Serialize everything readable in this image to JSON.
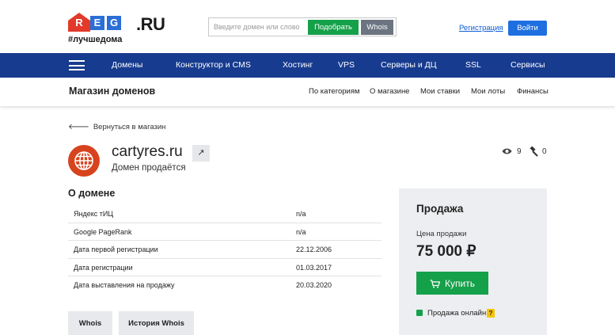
{
  "header": {
    "logo": {
      "letters": [
        "R",
        "E",
        "G"
      ],
      "suffix": ".RU",
      "tagline": "#лучшедома"
    },
    "search": {
      "placeholder": "Введите домен или слово",
      "pick_label": "Подобрать",
      "whois_label": "Whois"
    },
    "register_link": "Регистрация",
    "login_label": "Войти"
  },
  "nav": {
    "items": [
      "Домены",
      "Конструктор и CMS",
      "Хостинг",
      "VPS",
      "Серверы и ДЦ",
      "SSL",
      "Сервисы"
    ]
  },
  "subnav": {
    "title": "Магазин доменов",
    "items": [
      "По категориям",
      "О магазине",
      "Мои ставки",
      "Мои лоты",
      "Финансы"
    ]
  },
  "back_link": "Вернуться в магазин",
  "domain": {
    "name": "cartyres.ru",
    "status": "Домен продаётся",
    "views": "9",
    "bids": "0"
  },
  "about": {
    "title": "О домене",
    "rows": [
      {
        "label": "Яндекс тИЦ",
        "value": "n/a"
      },
      {
        "label": "Google PageRank",
        "value": "n/a"
      },
      {
        "label": "Дата первой регистрации",
        "value": "22.12.2006"
      },
      {
        "label": "Дата регистрации",
        "value": "01.03.2017"
      },
      {
        "label": "Дата выставления на продажу",
        "value": "20.03.2020"
      }
    ],
    "buttons": [
      "Whois",
      "История Whois"
    ]
  },
  "sale": {
    "title": "Продажа",
    "price_label": "Цена продажи",
    "price": "75 000 ₽",
    "buy_label": "Купить",
    "online_label": "Продажа онлайн",
    "help": "?",
    "online_checked": true
  },
  "colors": {
    "brand_blue": "#173b8f",
    "accent_green": "#15a04a",
    "button_blue": "#1f6fe0",
    "logo_red": "#e23a2a",
    "domain_icon": "#d7431e"
  }
}
